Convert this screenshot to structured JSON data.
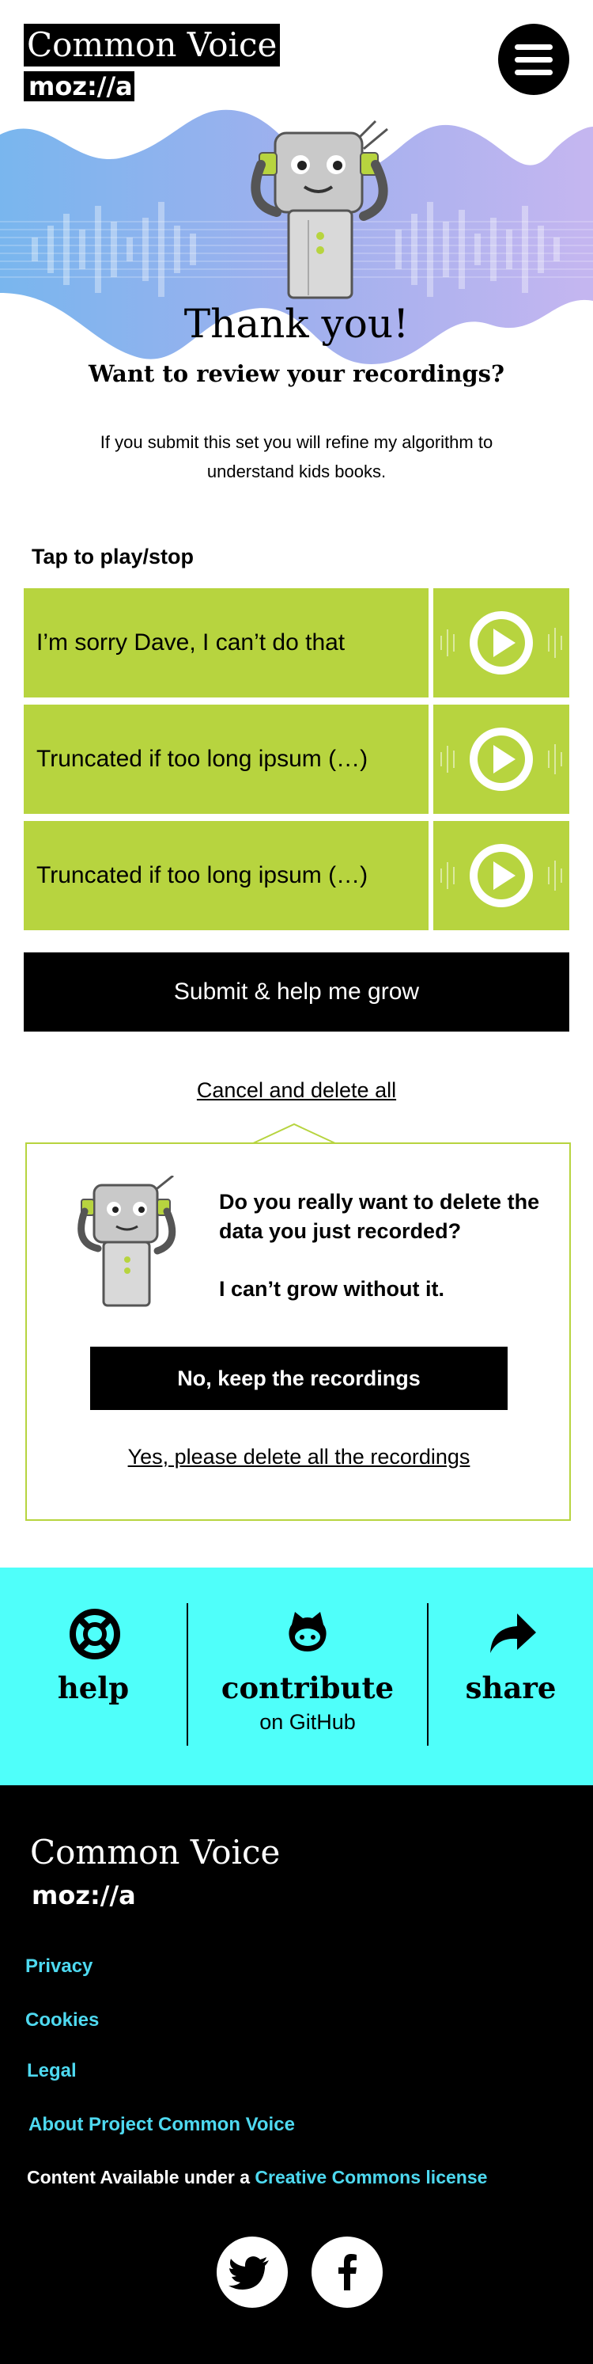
{
  "header": {
    "brand_title": "Common Voice",
    "brand_sub": "moz://a",
    "menu_icon": "hamburger-menu-icon"
  },
  "hero": {
    "title": "Thank you!",
    "subtitle": "Want to review your recordings?",
    "description": "If you submit this set you will refine my algorithm to understand kids books."
  },
  "recordings": {
    "label": "Tap to play/stop",
    "items": [
      {
        "text": "I’m sorry Dave, I can’t do that"
      },
      {
        "text": "Truncated if too long ipsum (…)"
      },
      {
        "text": "Truncated if too long ipsum (…)"
      }
    ],
    "play_icon": "play-icon"
  },
  "actions": {
    "submit_label": "Submit & help me grow",
    "cancel_label": "Cancel and delete all"
  },
  "dialog": {
    "question": "Do you really want to delete the data you just recorded?",
    "note": "I can’t grow without it.",
    "keep_label": "No, keep the recordings",
    "delete_label": "Yes, please delete all the recordings"
  },
  "help_band": {
    "help_label": "help",
    "contribute_label": "contribute",
    "contribute_sub": "on GitHub",
    "share_label": "share"
  },
  "footer": {
    "title": "Common Voice",
    "moz": "moz://a",
    "links": [
      "Privacy",
      "Cookies",
      "Legal",
      "About Project Common Voice"
    ],
    "license_prefix": "Content Available under a",
    "license_link": "Creative Commons license",
    "social": [
      "twitter-icon",
      "facebook-icon"
    ]
  },
  "colors": {
    "accent_green": "#b7d43f",
    "cyan": "#4ffffa",
    "footer_link": "#4ed9f0"
  }
}
